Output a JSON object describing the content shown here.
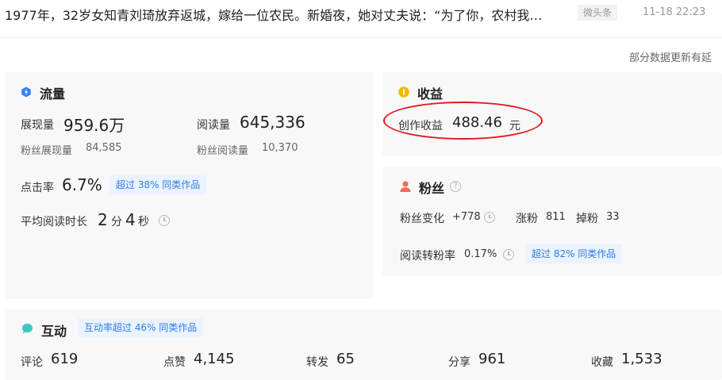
{
  "header": {
    "article_title": "1977年，32岁女知青刘琦放弃返城，嫁给一位农民。新婚夜，她对丈夫说：“为了你，农村我…",
    "source": "微头条",
    "publish_time": "11-18 22:23"
  },
  "notice": "部分数据更新有延",
  "traffic": {
    "title": "流量",
    "impressions_label": "展现量",
    "impressions_value": "959.6万",
    "reads_label": "阅读量",
    "reads_value": "645,336",
    "fan_impressions_label": "粉丝展现量",
    "fan_impressions_value": "84,585",
    "fan_reads_label": "粉丝阅读量",
    "fan_reads_value": "10,370",
    "ctr_label": "点击率",
    "ctr_value": "6.7%",
    "ctr_chip": "超过 38% 同类作品",
    "avg_read_label": "平均阅读时长",
    "avg_min_value": "2",
    "avg_min_unit": "分",
    "avg_sec_value": "4",
    "avg_sec_unit": "秒"
  },
  "income": {
    "title": "收益",
    "label": "创作收益",
    "value": "488.46",
    "unit": "元"
  },
  "fans": {
    "title": "粉丝",
    "change_label": "粉丝变化",
    "change_value": "+778",
    "gain_label": "涨粉",
    "gain_value": "811",
    "loss_label": "掉粉",
    "loss_value": "33",
    "conversion_label": "阅读转粉率",
    "conversion_value": "0.17%",
    "conversion_chip": "超过 82% 同类作品"
  },
  "interaction": {
    "title": "互动",
    "chip": "互动率超过 46% 同类作品",
    "stats": [
      {
        "label": "评论",
        "value": "619"
      },
      {
        "label": "点赞",
        "value": "4,145"
      },
      {
        "label": "转发",
        "value": "65"
      },
      {
        "label": "分享",
        "value": "961"
      },
      {
        "label": "收藏",
        "value": "1,533"
      }
    ]
  },
  "colors": {
    "traffic_icon": "#3b82f6",
    "income_icon": "#f5b800",
    "fans_icon": "#f26b5b",
    "interact_icon": "#3cc7c2",
    "chip_text": "#2f7de1",
    "chip_bg": "#eaf3ff",
    "highlight": "#e0191e"
  }
}
